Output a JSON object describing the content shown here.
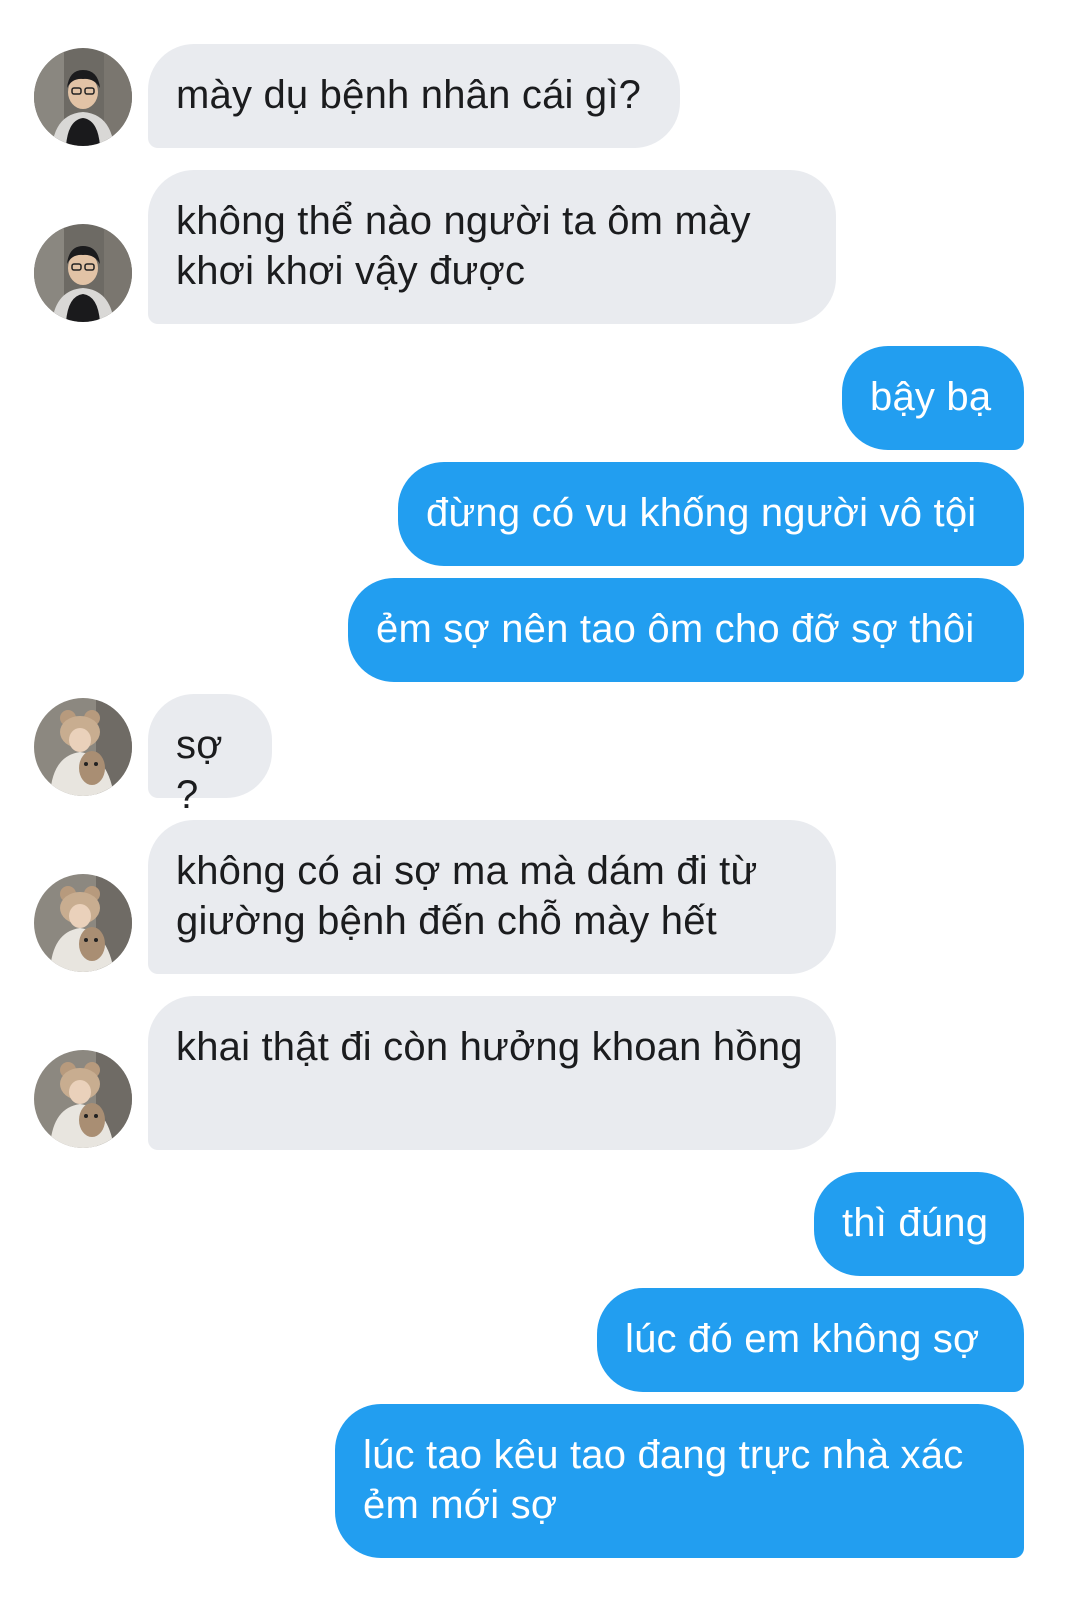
{
  "conversation": {
    "messages": [
      {
        "side": "in",
        "avatar": "avatar-a",
        "text": "mày dụ bệnh nhân cái gì?"
      },
      {
        "side": "in",
        "avatar": "avatar-a",
        "text": "không thể nào người ta ôm mày khơi khơi vậy được"
      },
      {
        "side": "out",
        "text": "bậy bạ"
      },
      {
        "side": "out",
        "text": "đừng có vu khống người vô tội"
      },
      {
        "side": "out",
        "text": "ẻm sợ nên tao ôm cho đỡ sợ thôi"
      },
      {
        "side": "in",
        "avatar": "avatar-b",
        "text": "sợ?"
      },
      {
        "side": "in",
        "avatar": "avatar-b",
        "text": "không có ai sợ ma mà dám đi từ giường bệnh đến chỗ mày hết"
      },
      {
        "side": "in",
        "avatar": "avatar-b",
        "text": "khai thật đi còn hưởng khoan hồng"
      },
      {
        "side": "out",
        "text": "thì đúng"
      },
      {
        "side": "out",
        "text": "lúc đó em không sợ"
      },
      {
        "side": "out",
        "text": "lúc tao kêu tao đang trực nhà xác ẻm mới sợ"
      }
    ]
  },
  "colors": {
    "incoming_bubble": "#e9ebef",
    "outgoing_bubble": "#229ef0",
    "incoming_text": "#1b1c1e",
    "outgoing_text": "#ffffff"
  },
  "icons": {
    "avatar_a": "person-photo-avatar",
    "avatar_b": "person-with-bear-hat-avatar"
  }
}
